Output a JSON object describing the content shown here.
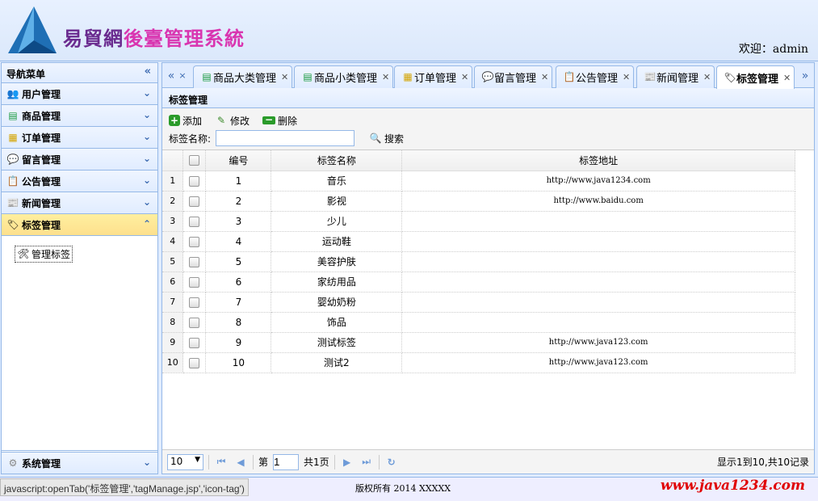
{
  "header": {
    "title_part1": "易貿網",
    "title_part2": "後臺管理系統",
    "welcome": "欢迎：admin"
  },
  "nav": {
    "title": "导航菜单",
    "items": [
      {
        "label": "用户管理",
        "icon": "user-icon"
      },
      {
        "label": "商品管理",
        "icon": "list-icon"
      },
      {
        "label": "订单管理",
        "icon": "order-icon"
      },
      {
        "label": "留言管理",
        "icon": "comment-icon"
      },
      {
        "label": "公告管理",
        "icon": "notice-icon"
      },
      {
        "label": "新闻管理",
        "icon": "news-icon"
      },
      {
        "label": "标签管理",
        "icon": "tag-icon"
      }
    ],
    "sub_item": "管理标签",
    "system": "系统管理"
  },
  "tabs": [
    {
      "label": "商品大类管理",
      "icon": "list-icon"
    },
    {
      "label": "商品小类管理",
      "icon": "list-icon"
    },
    {
      "label": "订单管理",
      "icon": "order-icon"
    },
    {
      "label": "留言管理",
      "icon": "comment-icon"
    },
    {
      "label": "公告管理",
      "icon": "notice-icon"
    },
    {
      "label": "新闻管理",
      "icon": "news-icon"
    },
    {
      "label": "标签管理",
      "icon": "tag-icon",
      "selected": true
    }
  ],
  "grid": {
    "title": "标签管理",
    "toolbar": {
      "add": "添加",
      "edit": "修改",
      "delete": "删除",
      "search_label": "标签名称:",
      "search_button": "搜索",
      "search_value": ""
    },
    "columns": [
      "编号",
      "标签名称",
      "标签地址"
    ],
    "rows": [
      {
        "rn": "1",
        "id": "1",
        "name": "音乐",
        "url": "http://www.java1234.com"
      },
      {
        "rn": "2",
        "id": "2",
        "name": "影视",
        "url": "http://www.baidu.com"
      },
      {
        "rn": "3",
        "id": "3",
        "name": "少儿",
        "url": ""
      },
      {
        "rn": "4",
        "id": "4",
        "name": "运动鞋",
        "url": ""
      },
      {
        "rn": "5",
        "id": "5",
        "name": "美容护肤",
        "url": ""
      },
      {
        "rn": "6",
        "id": "6",
        "name": "家纺用品",
        "url": ""
      },
      {
        "rn": "7",
        "id": "7",
        "name": "婴幼奶粉",
        "url": ""
      },
      {
        "rn": "8",
        "id": "8",
        "name": "饰品",
        "url": ""
      },
      {
        "rn": "9",
        "id": "9",
        "name": "测试标签",
        "url": "http://www.java123.com"
      },
      {
        "rn": "10",
        "id": "10",
        "name": "测试2",
        "url": "http://www.java123.com"
      }
    ]
  },
  "pager": {
    "page_size": "10",
    "page_prefix": "第",
    "page": "1",
    "page_total": "共1页",
    "info": "显示1到10,共10记录"
  },
  "footer": {
    "status": "javascript:openTab('标签管理','tagManage.jsp','icon-tag')",
    "copyright": "版权所有 2014 XXXXX",
    "watermark": "www.java1234.com"
  }
}
